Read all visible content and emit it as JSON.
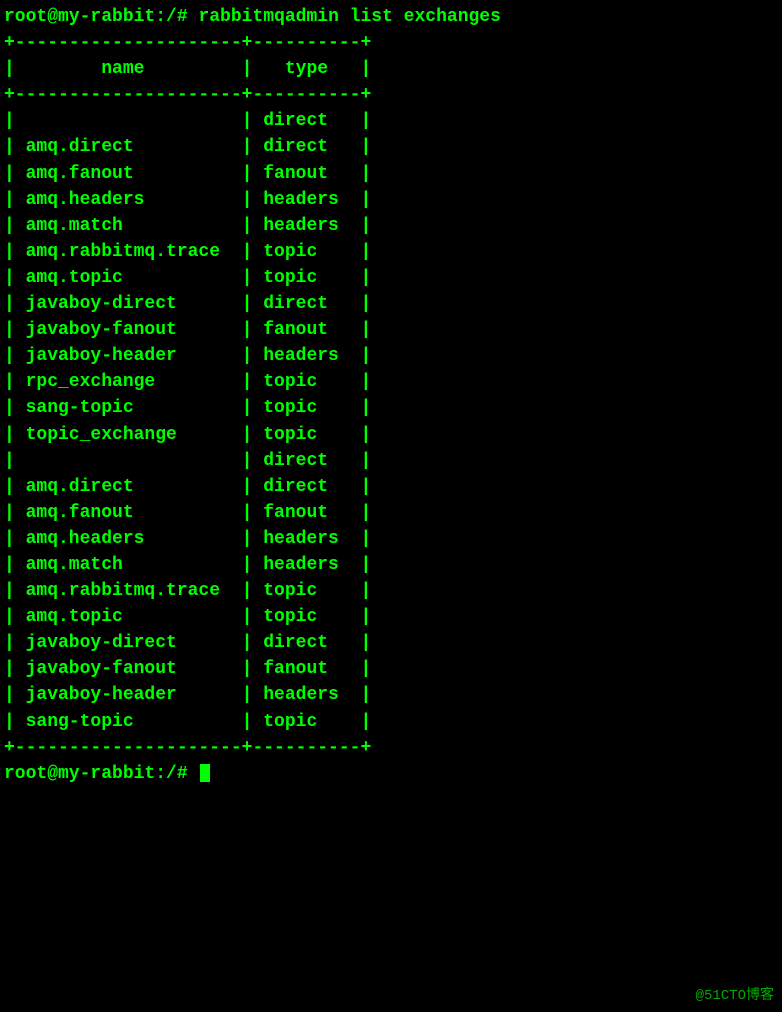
{
  "terminal": {
    "prompt": "root@my-rabbit:/#",
    "command": "rabbitmqadmin list exchanges",
    "separator_top": "+---------------------+----------+",
    "header_row": "|        name         |   type   |",
    "separator_mid": "+---------------------+----------+",
    "rows": [
      {
        "name": "",
        "type": "direct"
      },
      {
        "name": "amq.direct",
        "type": "direct"
      },
      {
        "name": "amq.fanout",
        "type": "fanout"
      },
      {
        "name": "amq.headers",
        "type": "headers"
      },
      {
        "name": "amq.match",
        "type": "headers"
      },
      {
        "name": "amq.rabbitmq.trace",
        "type": "topic"
      },
      {
        "name": "amq.topic",
        "type": "topic"
      },
      {
        "name": "javaboy-direct",
        "type": "direct"
      },
      {
        "name": "javaboy-fanout",
        "type": "fanout"
      },
      {
        "name": "javaboy-header",
        "type": "headers"
      },
      {
        "name": "rpc_exchange",
        "type": "topic"
      },
      {
        "name": "sang-topic",
        "type": "topic"
      },
      {
        "name": "topic_exchange",
        "type": "topic"
      },
      {
        "name": "",
        "type": "direct"
      },
      {
        "name": "amq.direct",
        "type": "direct"
      },
      {
        "name": "amq.fanout",
        "type": "fanout"
      },
      {
        "name": "amq.headers",
        "type": "headers"
      },
      {
        "name": "amq.match",
        "type": "headers"
      },
      {
        "name": "amq.rabbitmq.trace",
        "type": "topic"
      },
      {
        "name": "amq.topic",
        "type": "topic"
      },
      {
        "name": "javaboy-direct",
        "type": "direct"
      },
      {
        "name": "javaboy-fanout",
        "type": "fanout"
      },
      {
        "name": "javaboy-header",
        "type": "headers"
      },
      {
        "name": "sang-topic",
        "type": "topic"
      }
    ],
    "separator_bottom": "+---------------------+----------+",
    "prompt_end": "root@my-rabbit:/#",
    "watermark": "@51CTO博客"
  }
}
